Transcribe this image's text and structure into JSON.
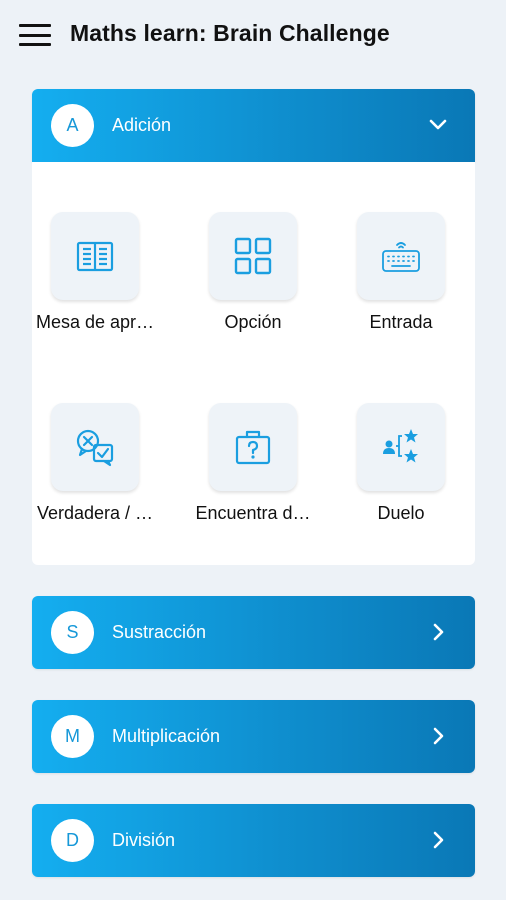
{
  "app": {
    "title": "Maths learn: Brain Challenge",
    "menu_icon": "hamburger-menu-icon"
  },
  "colors": {
    "accent_start": "#14aef0",
    "accent_end": "#0a78b6",
    "icon_blue": "#1a9ee0",
    "background": "#edf2f7"
  },
  "sections": [
    {
      "letter": "A",
      "label": "Adición",
      "expanded": true,
      "items": [
        {
          "label": "Mesa de apr…",
          "icon": "open-book-icon"
        },
        {
          "label": "Opción",
          "icon": "grid-icon"
        },
        {
          "label": "Entrada",
          "icon": "keyboard-icon"
        },
        {
          "label": "Verdadera / …",
          "icon": "true-false-bubbles-icon"
        },
        {
          "label": "Encuentra d…",
          "icon": "question-briefcase-icon"
        },
        {
          "label": "Duelo",
          "icon": "duel-stars-icon"
        }
      ]
    },
    {
      "letter": "S",
      "label": "Sustracción",
      "expanded": false
    },
    {
      "letter": "M",
      "label": "Multiplicación",
      "expanded": false
    },
    {
      "letter": "D",
      "label": "División",
      "expanded": false
    }
  ]
}
